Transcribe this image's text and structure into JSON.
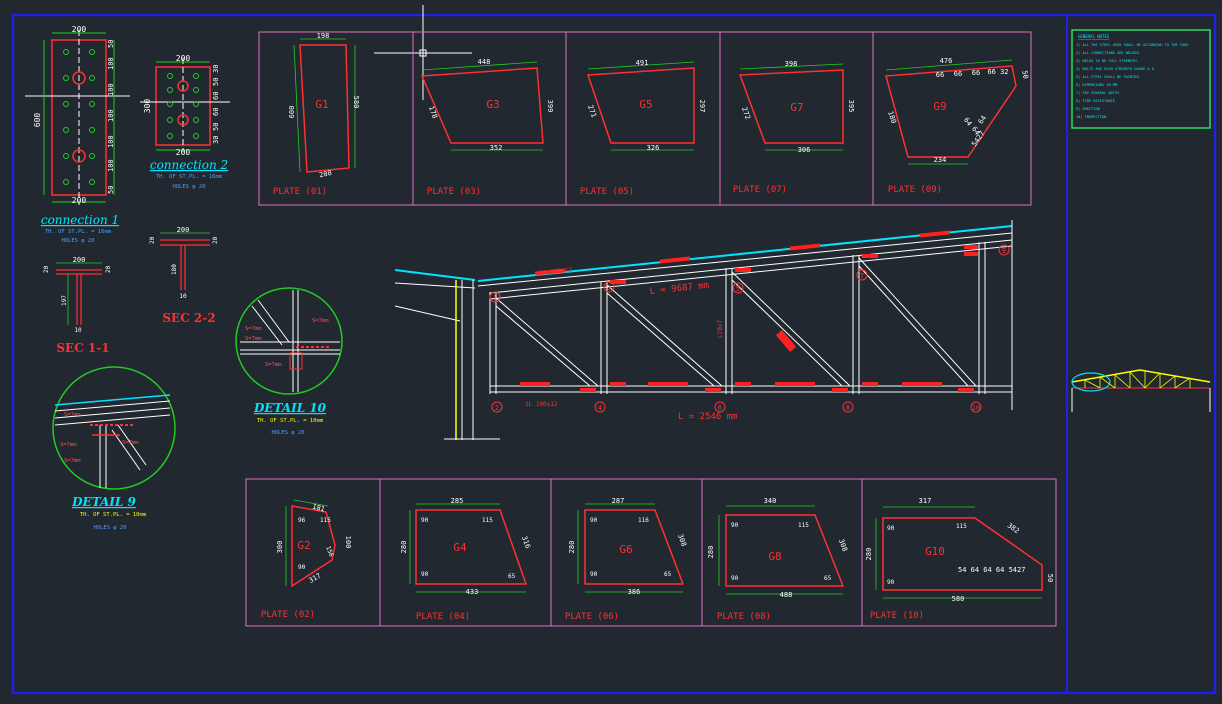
{
  "connection1": {
    "title": "connection 1",
    "sub": "TH. OF ST.PL. = 16mm",
    "holes": "HOLES φ 20",
    "dim_top": "200",
    "dim_bottom": "200",
    "dim_left": "600",
    "dims_right": [
      "50",
      "100",
      "100",
      "100",
      "100",
      "100",
      "50"
    ]
  },
  "connection2": {
    "title": "connection 2",
    "sub": "TH. OF ST.PL. = 16mm",
    "holes": "HOLES φ 20",
    "dim_top": "200",
    "dim_bottom": "200",
    "dim_left": "300",
    "dims_right": [
      "30",
      "50",
      "60",
      "60",
      "50",
      "30"
    ]
  },
  "sec11": {
    "title": "SEC 1-1",
    "dim_top": "200",
    "d1": "20",
    "d2": "20",
    "d3": "197",
    "d4": "10"
  },
  "sec22": {
    "title": "SEC 2-2",
    "dim_top": "200",
    "d1": "20",
    "d2": "20",
    "d3": "180",
    "d4": "10"
  },
  "detail10": {
    "title": "DETAIL 10",
    "sub": "TH. OF ST.PL. = 10mm",
    "holes": "HOLES φ 20",
    "w1": "S=7mm",
    "w2": "S=7mm",
    "w3": "S=7mm",
    "w4": "S=7mm"
  },
  "detail9": {
    "title": "DETAIL 9",
    "sub": "TH. OF ST.PL. = 10mm",
    "holes": "HOLES φ 20",
    "w1": "S=7mm",
    "w2": "S=7mm",
    "w3": "S=7mm",
    "w4": "S=7mm"
  },
  "plates_top": [
    {
      "label": "PLATE (01)",
      "name": "G1",
      "dims": [
        "198",
        "600",
        "580",
        "208"
      ]
    },
    {
      "label": "PLATE (03)",
      "name": "G3",
      "dims": [
        "448",
        "178",
        "399",
        "352"
      ]
    },
    {
      "label": "PLATE (05)",
      "name": "G5",
      "dims": [
        "491",
        "271",
        "297",
        "326"
      ]
    },
    {
      "label": "PLATE (07)",
      "name": "G7",
      "dims": [
        "398",
        "272",
        "395",
        "306"
      ]
    },
    {
      "label": "PLATE (09)",
      "name": "G9",
      "dims": [
        "476",
        "180",
        "50",
        "234",
        "66",
        "66",
        "66",
        "66 32",
        "64",
        "64",
        "64",
        "5427"
      ]
    }
  ],
  "plates_bottom": [
    {
      "label": "PLATE (02)",
      "name": "G2",
      "dims": [
        "300",
        "181",
        "100",
        "156",
        "317",
        "90",
        "96",
        "115"
      ]
    },
    {
      "label": "PLATE (04)",
      "name": "G4",
      "dims": [
        "285",
        "280",
        "316",
        "433",
        "90",
        "115",
        "90",
        "65"
      ]
    },
    {
      "label": "PLATE (06)",
      "name": "G6",
      "dims": [
        "287",
        "280",
        "308",
        "386",
        "90",
        "116",
        "90",
        "65"
      ]
    },
    {
      "label": "PLATE (08)",
      "name": "G8",
      "dims": [
        "340",
        "280",
        "308",
        "488",
        "90",
        "115",
        "90",
        "65"
      ]
    },
    {
      "label": "PLATE (10)",
      "name": "G10",
      "dims": [
        "317",
        "280",
        "382",
        "580",
        "90",
        "115",
        "90",
        "54 64 64 64 5427",
        "50"
      ]
    }
  ],
  "truss": {
    "top_length": "L = 9687 mm",
    "bottom_length": "L = 2546 mm",
    "nodes": [
      "2",
      "4",
      "6",
      "8",
      "10",
      "1",
      "3",
      "5",
      "7",
      "9"
    ],
    "member_label": "L70x7",
    "chord_label": "2L 100x12",
    "bottom_label": "2L 100x12"
  },
  "notes": [
    "1) ALL THE STEEL USED SHALL BE ACCORDING TO THE CODE",
    "2) ALL CONNECTIONS ARE WELDED",
    "3) WELDS TO BE FULL STRENGTH",
    "4) BOLTS ARE HIGH STRENGTH GRADE 8.8",
    "5) ALL STEEL SHALL BE PAINTED",
    "6) DIMENSIONS IN MM",
    "7) SEE GENERAL NOTES",
    "8) FIRE RESISTANCE",
    "9) ERECTION",
    "10) INSPECTION"
  ],
  "notes_title": "GENERAL NOTES"
}
